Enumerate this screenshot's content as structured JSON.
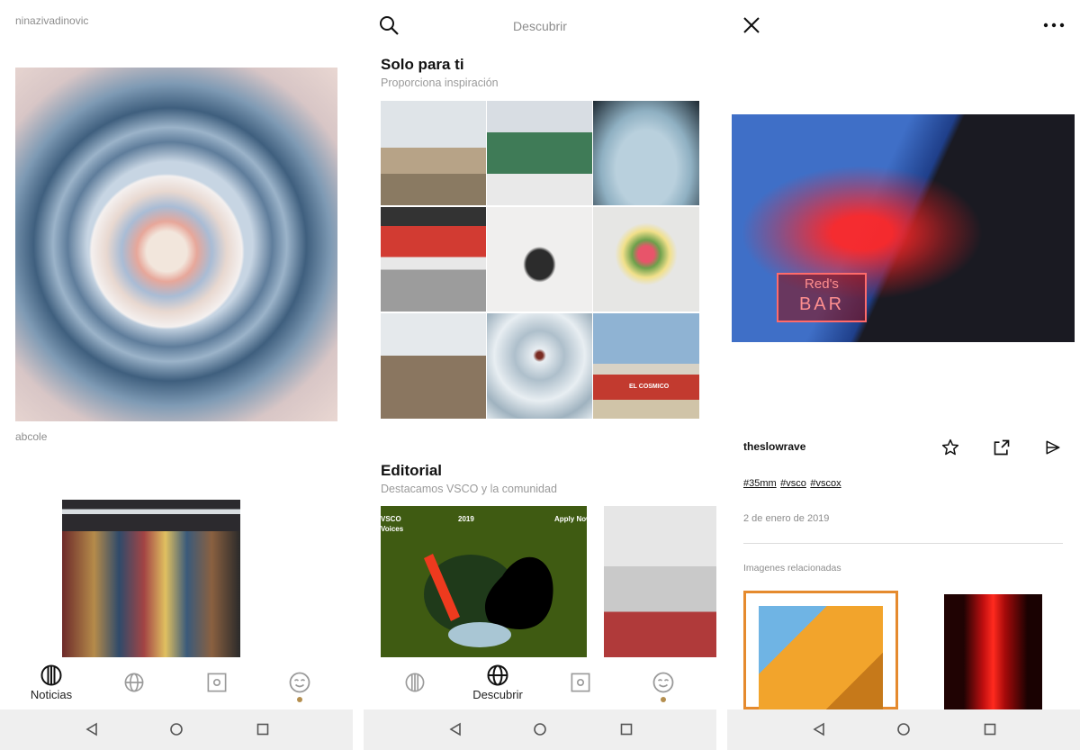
{
  "screen1": {
    "author1": "ninazivadinovic",
    "author2": "abcole"
  },
  "screen2": {
    "header_title": "Descubrir",
    "section1_title": "Solo para ti",
    "section1_subtitle": "Proporciona inspiración",
    "section2_title": "Editorial",
    "section2_subtitle": "Destacamos VSCO y la comunidad",
    "poster_brand": "VSCO",
    "poster_voices": "Voices",
    "poster_year": "2019",
    "poster_apply": "Apply Now",
    "car_sign": "EL COSMICO"
  },
  "screen3": {
    "neon_line1": "Red's",
    "neon_line2": "BAR",
    "username": "theslowrave",
    "tags": [
      "#35mm",
      "#vsco",
      "#vscox"
    ],
    "date": "2 de enero de 2019",
    "related_label": "Imagenes relacionadas"
  },
  "tabs": {
    "feed_label": "Noticias",
    "discover_label": "Descubrir"
  },
  "colors": {
    "accent_dot": "#b48e4e",
    "related_border": "#e58a2e",
    "navbar_bg": "#efefef"
  }
}
